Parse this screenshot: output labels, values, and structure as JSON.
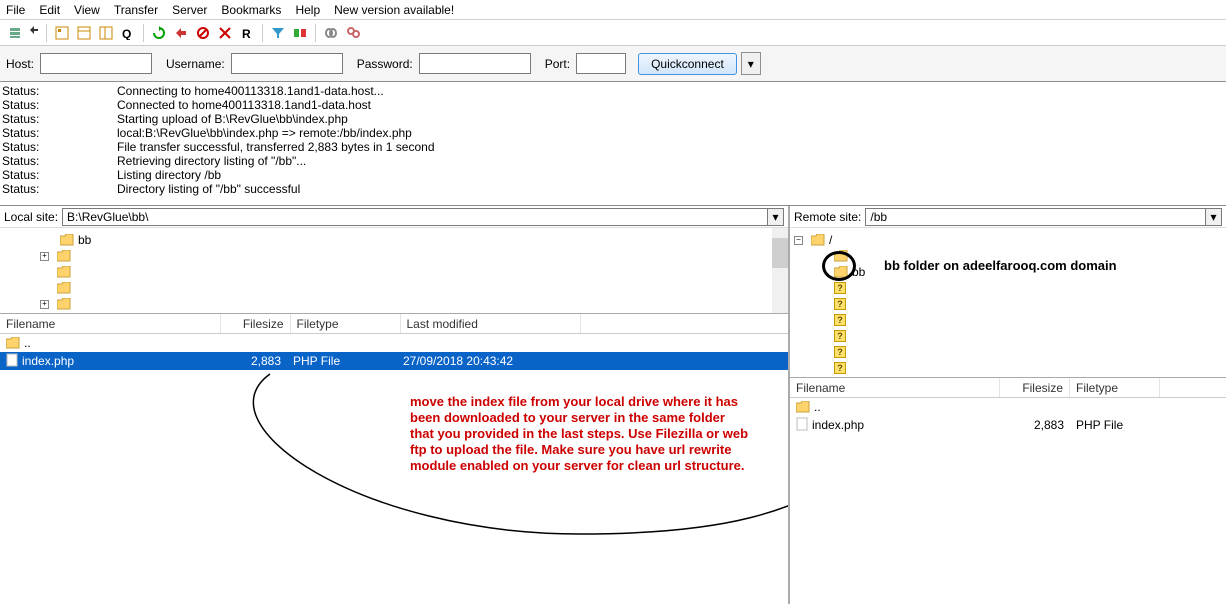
{
  "menu": {
    "items": [
      "File",
      "Edit",
      "View",
      "Transfer",
      "Server",
      "Bookmarks",
      "Help",
      "New version available!"
    ]
  },
  "conn": {
    "host_label": "Host:",
    "user_label": "Username:",
    "pass_label": "Password:",
    "port_label": "Port:",
    "quick": "Quickconnect"
  },
  "log": [
    {
      "label": "Status:",
      "msg": "Connecting to home400113318.1and1-data.host..."
    },
    {
      "label": "Status:",
      "msg": "Connected to home400113318.1and1-data.host"
    },
    {
      "label": "Status:",
      "msg": "Starting upload of B:\\RevGlue\\bb\\index.php"
    },
    {
      "label": "Status:",
      "msg": "local:B:\\RevGlue\\bb\\index.php => remote:/bb/index.php"
    },
    {
      "label": "Status:",
      "msg": "File transfer successful, transferred 2,883 bytes in 1 second"
    },
    {
      "label": "Status:",
      "msg": "Retrieving directory listing of \"/bb\"..."
    },
    {
      "label": "Status:",
      "msg": "Listing directory /bb"
    },
    {
      "label": "Status:",
      "msg": "Directory listing of \"/bb\" successful"
    }
  ],
  "local": {
    "site_label": "Local site:",
    "path": "B:\\RevGlue\\bb\\",
    "tree": {
      "bb": "bb"
    },
    "headers": {
      "name": "Filename",
      "size": "Filesize",
      "type": "Filetype",
      "mod": "Last modified"
    },
    "files": [
      {
        "name": "..",
        "size": "",
        "type": "",
        "mod": "",
        "up": true
      },
      {
        "name": "index.php",
        "size": "2,883",
        "type": "PHP File",
        "mod": "27/09/2018 20:43:42",
        "sel": true
      }
    ]
  },
  "remote": {
    "site_label": "Remote site:",
    "path": "/bb",
    "root": "/",
    "bb": "bb",
    "headers": {
      "name": "Filename",
      "size": "Filesize",
      "type": "Filetype"
    },
    "files": [
      {
        "name": "..",
        "size": "",
        "type": "",
        "up": true
      },
      {
        "name": "index.php",
        "size": "2,883",
        "type": "PHP File"
      }
    ]
  },
  "annotation_left": "move the index file from your local drive where it has been downloaded to your server in the same folder that you provided in the last steps. Use Filezilla or web ftp to upload the file. Make sure you have url rewrite module enabled on your server for clean url structure.",
  "annotation_right": "bb folder on adeelfarooq.com domain"
}
